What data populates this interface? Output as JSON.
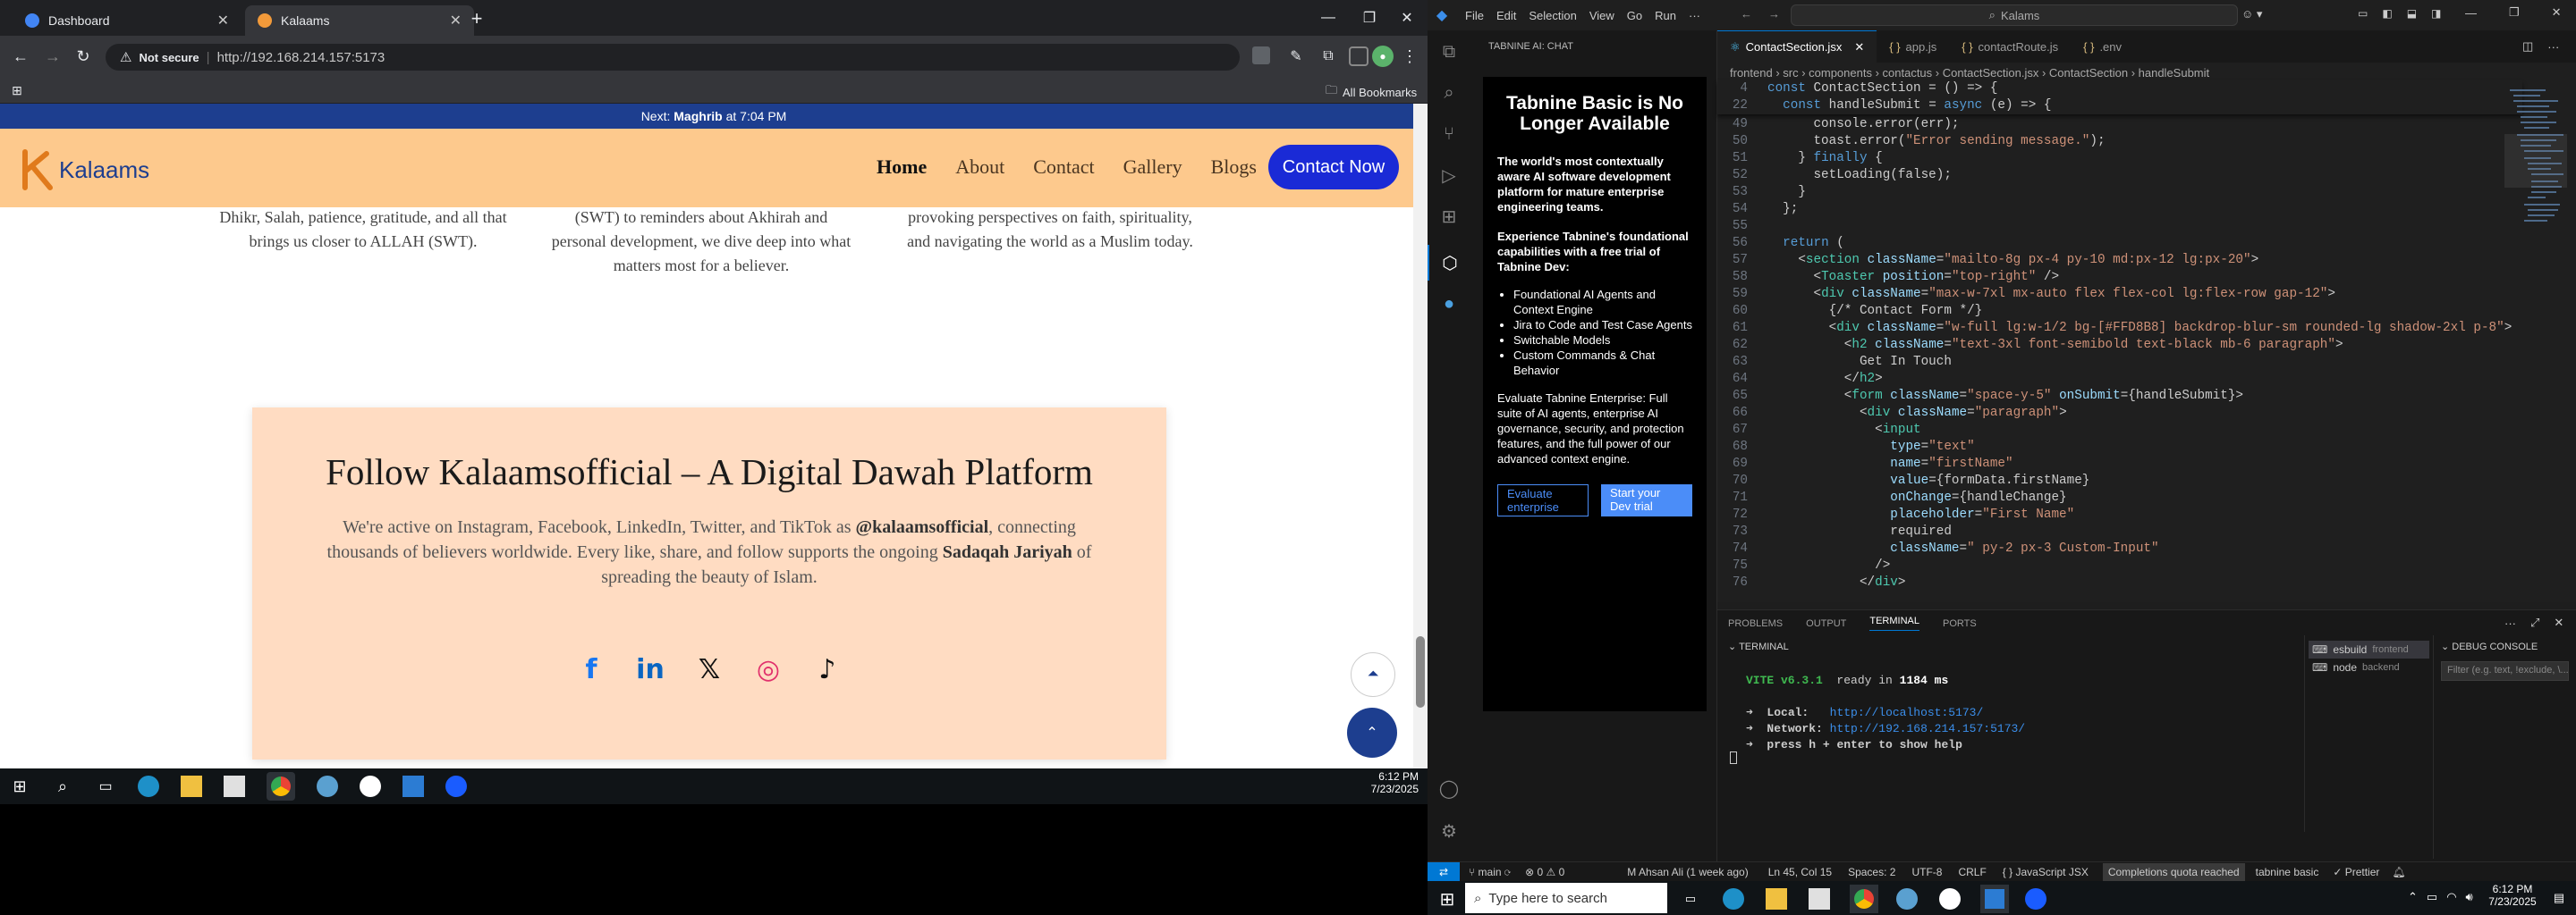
{
  "browser": {
    "tabs": [
      {
        "title": "Dashboard"
      },
      {
        "title": "Kalaams"
      }
    ],
    "not_secure": "Not secure",
    "url": "http://192.168.214.157:5173",
    "bookmarks_label": "All Bookmarks"
  },
  "site": {
    "announcement_prefix": "Next: ",
    "announcement_bold": "Maghrib",
    "announcement_suffix": " at 7:04 PM",
    "logo_text": "Kalaams",
    "nav": [
      "Home",
      "About",
      "Contact",
      "Gallery",
      "Blogs"
    ],
    "cta": "Contact Now",
    "features": [
      "Dhikr, Salah, patience, gratitude, and all that brings us closer to ALLAH (SWT).",
      "(SWT) to reminders about Akhirah and personal development, we dive deep into what matters most for a believer.",
      "provoking perspectives on faith, spirituality, and navigating the world as a Muslim today."
    ],
    "card_title": "Follow Kalaamsofficial – A Digital Dawah Platform",
    "card_p1": "We're active on Instagram, Facebook, LinkedIn, Twitter, and TikTok as ",
    "card_handle": "@kalaamsofficial",
    "card_p2": ", connecting thousands of believers worldwide. Every like, share, and follow supports the ongoing ",
    "card_bold": "Sadaqah Jariyah",
    "card_p3": " of spreading the beauty of Islam.",
    "social": [
      {
        "name": "facebook",
        "glyph": "f",
        "color": "#1877f2"
      },
      {
        "name": "linkedin",
        "glyph": "in",
        "color": "#0a66c2"
      },
      {
        "name": "x",
        "glyph": "𝕏",
        "color": "#111111"
      },
      {
        "name": "instagram",
        "glyph": "◎",
        "color": "#e1306c"
      },
      {
        "name": "tiktok",
        "glyph": "♪",
        "color": "#111111"
      }
    ]
  },
  "taskbar_left": {
    "time": "6:12 PM",
    "date": "7/23/2025"
  },
  "vscode": {
    "menu": [
      "File",
      "Edit",
      "Selection",
      "View",
      "Go",
      "Run",
      "···"
    ],
    "search": "Kalams",
    "side_title": "TABNINE AI: CHAT",
    "tabnine": {
      "heading": "Tabnine Basic is No Longer Available",
      "p1": "The world's most contextually aware AI software development platform for mature enterprise engineering teams.",
      "p2": "Experience Tabnine's foundational capabilities with a free trial of Tabnine Dev:",
      "bullets": [
        "Foundational AI Agents and Context Engine",
        "Jira to Code and Test Case Agents",
        "Switchable Models",
        "Custom Commands & Chat Behavior"
      ],
      "p3": "Evaluate Tabnine Enterprise: Full suite of AI agents, enterprise AI governance, security, and protection features, and the full power of our advanced context engine.",
      "btn1": "Evaluate enterprise",
      "btn2": "Start your Dev trial"
    },
    "tabs": [
      "ContactSection.jsx",
      "app.js",
      "contactRoute.js",
      ".env"
    ],
    "breadcrumb": "frontend › src › components › contactus › ContactSection.jsx › ContactSection › handleSubmit",
    "sticky": [
      {
        "n": "4",
        "t": "const ContactSection = () => {"
      },
      {
        "n": "22",
        "t": "  const handleSubmit = async (e) => {"
      }
    ],
    "code": [
      {
        "n": "49",
        "t": "      console.error(err);"
      },
      {
        "n": "50",
        "t": "      toast.error(\"Error sending message.\");"
      },
      {
        "n": "51",
        "t": "    } finally {"
      },
      {
        "n": "52",
        "t": "      setLoading(false);"
      },
      {
        "n": "53",
        "t": "    }"
      },
      {
        "n": "54",
        "t": "  };"
      },
      {
        "n": "55",
        "t": ""
      },
      {
        "n": "56",
        "t": "  return ("
      },
      {
        "n": "57",
        "t": "    <section className=\"mailto-8g px-4 py-10 md:px-12 lg:px-20\">"
      },
      {
        "n": "58",
        "t": "      <Toaster position=\"top-right\" />"
      },
      {
        "n": "59",
        "t": "      <div className=\"max-w-7xl mx-auto flex flex-col lg:flex-row gap-12\">"
      },
      {
        "n": "60",
        "t": "        {/* Contact Form */}"
      },
      {
        "n": "61",
        "t": "        <div className=\"w-full lg:w-1/2 bg-[#FFD8B8] backdrop-blur-sm rounded-lg shadow-2xl p-8\">"
      },
      {
        "n": "62",
        "t": "          <h2 className=\"text-3xl font-semibold text-black mb-6 paragraph\">"
      },
      {
        "n": "63",
        "t": "            Get In Touch"
      },
      {
        "n": "64",
        "t": "          </h2>"
      },
      {
        "n": "65",
        "t": "          <form className=\"space-y-5\" onSubmit={handleSubmit}>"
      },
      {
        "n": "66",
        "t": "            <div className=\"paragraph\">"
      },
      {
        "n": "67",
        "t": "              <input"
      },
      {
        "n": "68",
        "t": "                type=\"text\""
      },
      {
        "n": "69",
        "t": "                name=\"firstName\""
      },
      {
        "n": "70",
        "t": "                value={formData.firstName}"
      },
      {
        "n": "71",
        "t": "                onChange={handleChange}"
      },
      {
        "n": "72",
        "t": "                placeholder=\"First Name\""
      },
      {
        "n": "73",
        "t": "                required"
      },
      {
        "n": "74",
        "t": "                className=\" py-2 px-3 Custom-Input\""
      },
      {
        "n": "75",
        "t": "              />"
      },
      {
        "n": "76",
        "t": "            </div>"
      }
    ],
    "panel_tabs": [
      "PROBLEMS",
      "OUTPUT",
      "TERMINAL",
      "PORTS"
    ],
    "terminal_title": "TERMINAL",
    "terminal": [
      {
        "a": "VITE v6.3.1",
        "b": "  ready in ",
        "c": "1184 ms"
      },
      {
        "a": "➜  Local:",
        "b": "   ",
        "c": "http://localhost:5173/"
      },
      {
        "a": "➜  Network:",
        "b": " ",
        "c": "http://192.168.214.157:5173/"
      },
      {
        "a": "➜  press h + enter to show help",
        "b": "",
        "c": ""
      }
    ],
    "terminals": [
      {
        "name": "esbuild",
        "sub": "frontend"
      },
      {
        "name": "node",
        "sub": "backend"
      }
    ],
    "debug_title": "DEBUG CONSOLE",
    "debug_filter": "Filter (e.g. text, !exclude, \\...",
    "status": {
      "branch": "main",
      "errors": "⊗ 0 ⚠ 0",
      "blame": "M Ahsan Ali (1 week ago)",
      "pos": "Ln 45, Col 15",
      "spaces": "Spaces: 2",
      "enc": "UTF-8",
      "eol": "CRLF",
      "lang": "{ } JavaScript JSX",
      "quota": "Completions quota reached",
      "tabnine": "tabnine basic",
      "prettier": "✓ Prettier"
    },
    "taskbar": {
      "search": "Type here to search",
      "time": "6:12 PM",
      "date": "7/23/2025"
    }
  }
}
